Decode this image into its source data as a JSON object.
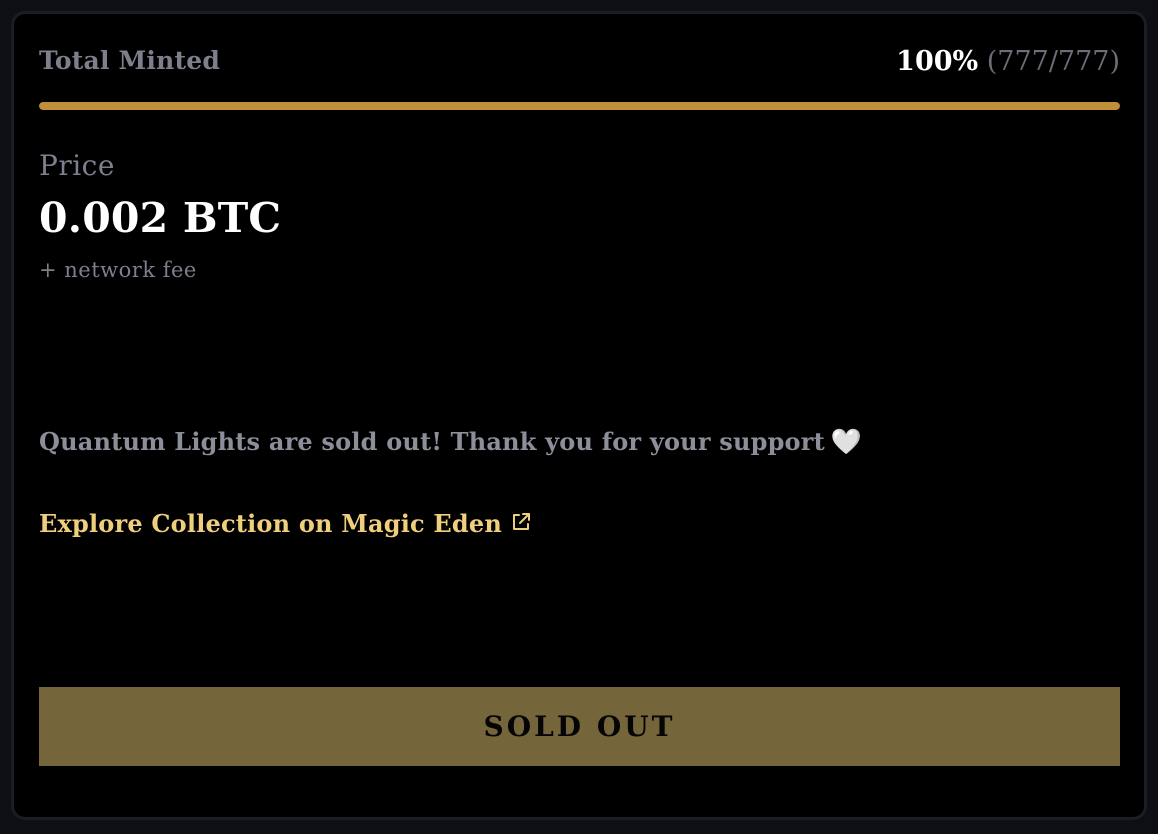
{
  "mint": {
    "label": "Total Minted",
    "percent_text": "100%",
    "count_text": "(777/777)",
    "progress": 1.0
  },
  "price": {
    "label": "Price",
    "value": "0.002 BTC",
    "fee_note": "+ network fee"
  },
  "message": {
    "text": "Quantum Lights are sold out! Thank you for your support",
    "emoji": "🤍"
  },
  "explore_link": {
    "label": "Explore Collection on Magic Eden",
    "icon": "external-link-icon"
  },
  "button": {
    "label": "SOLD OUT"
  },
  "colors": {
    "accent": "#c28f39",
    "link": "#f0cf7c",
    "button_bg": "#75653a",
    "muted_text": "#7d7f8c"
  }
}
